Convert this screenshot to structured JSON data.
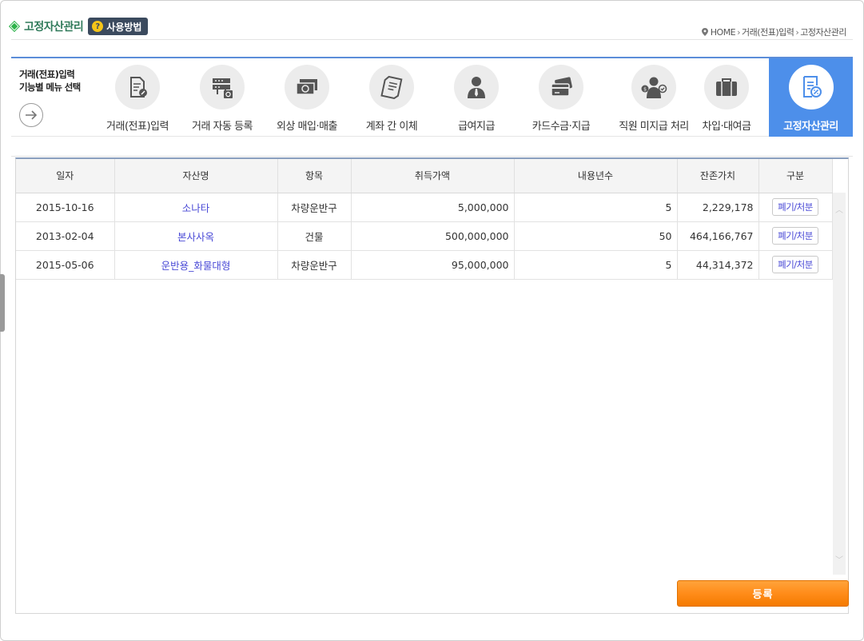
{
  "header": {
    "title": "고정자산관리",
    "help_label": "사용방법",
    "breadcrumb": [
      "HOME",
      "거래(전표)입력",
      "고정자산관리"
    ]
  },
  "menu": {
    "intro_line1": "거래(전표)입력",
    "intro_line2": "기능별 메뉴 선택",
    "items": [
      {
        "label": "거래(전표)입력",
        "icon": "document-pen-icon"
      },
      {
        "label": "거래 자동 등록",
        "icon": "server-sync-icon"
      },
      {
        "label": "외상 매입·매출",
        "icon": "money-bills-icon"
      },
      {
        "label": "계좌 간 이체",
        "icon": "receipt-icon"
      },
      {
        "label": "급여지급",
        "icon": "person-tie-icon"
      },
      {
        "label": "카드수금·지급",
        "icon": "cards-icon"
      },
      {
        "label": "직원 미지급 처리",
        "icon": "employee-money-icon"
      },
      {
        "label": "차입·대여금",
        "icon": "briefcase-icon"
      },
      {
        "label": "고정자산관리",
        "icon": "asset-document-icon",
        "active": true
      }
    ]
  },
  "table": {
    "headers": [
      "일자",
      "자산명",
      "항목",
      "취득가액",
      "내용년수",
      "잔존가치",
      "구분"
    ],
    "rows": [
      {
        "date": "2015-10-16",
        "name": "소나타",
        "category": "차량운반구",
        "cost": "5,000,000",
        "years": "5",
        "residual": "2,229,178",
        "action": "폐기/처분"
      },
      {
        "date": "2013-02-04",
        "name": "본사사옥",
        "category": "건물",
        "cost": "500,000,000",
        "years": "50",
        "residual": "464,166,767",
        "action": "폐기/처분"
      },
      {
        "date": "2015-05-06",
        "name": "운반용_화물대형",
        "category": "차량운반구",
        "cost": "95,000,000",
        "years": "5",
        "residual": "44,314,372",
        "action": "폐기/처분"
      }
    ]
  },
  "register_label": "등록",
  "colors": {
    "accent": "#4d8fea",
    "button": "#ff8c1a",
    "link": "#4a4ad6"
  }
}
